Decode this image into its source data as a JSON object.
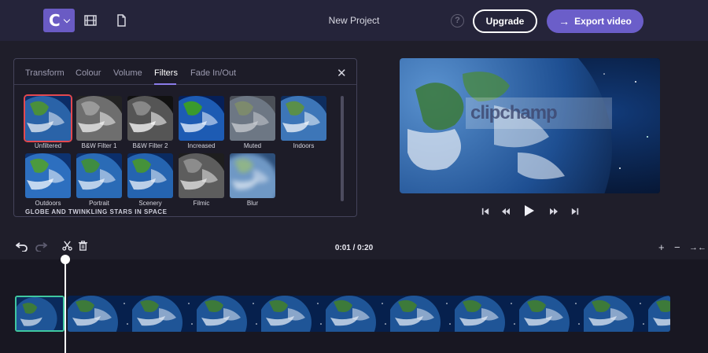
{
  "header": {
    "logo_letter": "C",
    "project_title": "New Project",
    "help_glyph": "?",
    "upgrade_label": "Upgrade",
    "export_label": "Export video",
    "export_icon": "arrow-right-icon",
    "colors": {
      "bar": "#25243a",
      "accent": "#6b5ec9"
    }
  },
  "panel": {
    "tabs": [
      "Transform",
      "Colour",
      "Volume",
      "Filters",
      "Fade In/Out"
    ],
    "active_tab": "Filters",
    "caption": "GLOBE AND TWINKLING STARS IN SPACE",
    "filters": [
      "Unfiltered",
      "B&W Filter 1",
      "B&W Filter 2",
      "Increased",
      "Muted",
      "Indoors",
      "Outdoors",
      "Portrait",
      "Scenery",
      "Filmic",
      "Blur"
    ],
    "selected_filter": "Unfiltered",
    "selected_color": "#e3484f"
  },
  "preview": {
    "watermark": "clipchamp"
  },
  "timeline": {
    "time_readout": "0:01 / 0:20",
    "clip_accent": "#3fc7a0"
  }
}
